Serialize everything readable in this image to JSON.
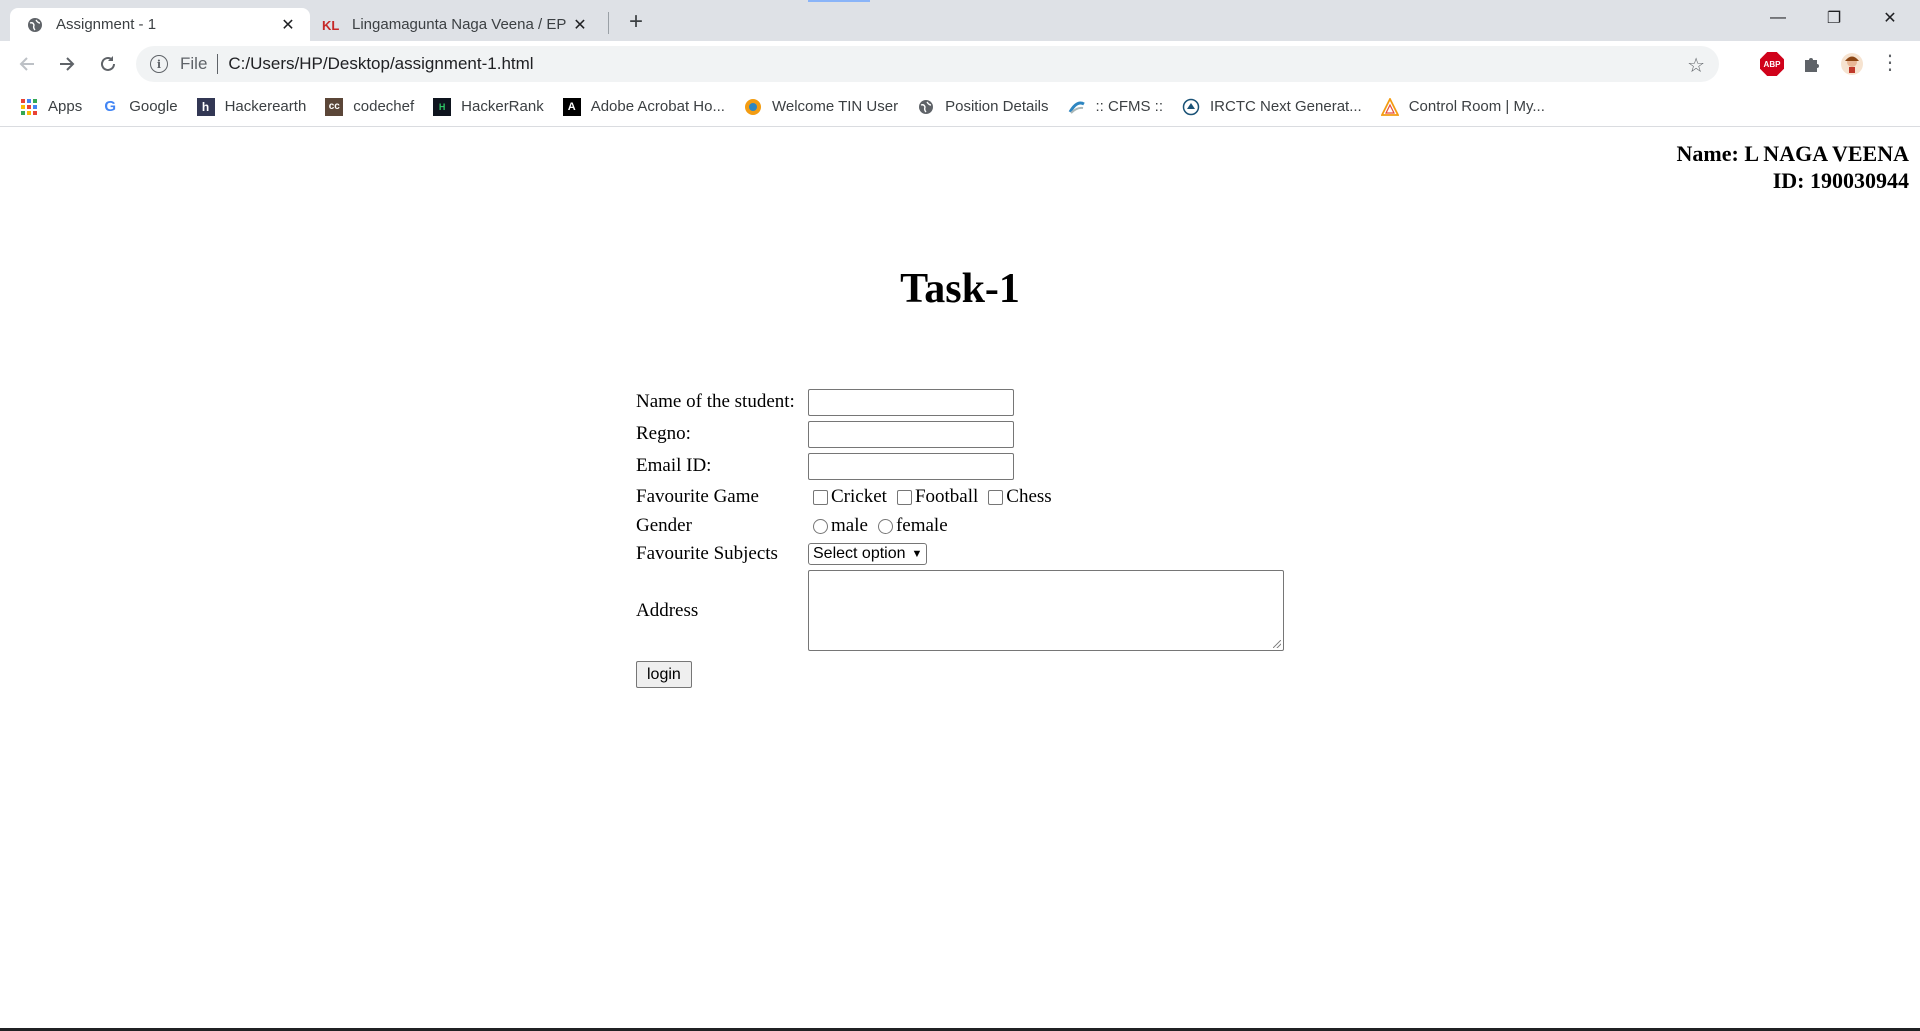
{
  "browser": {
    "tabs": [
      {
        "title": "Assignment - 1",
        "icon": "globe-icon",
        "active": true
      },
      {
        "title": "Lingamagunta Naga Veena / EP S",
        "icon": "kl-icon",
        "active": false
      }
    ],
    "close_glyph": "✕",
    "new_tab_glyph": "+",
    "window_controls": {
      "minimize": "—",
      "restore": "❐",
      "close": "✕"
    },
    "address": {
      "scheme": "File",
      "url": "C:/Users/HP/Desktop/assignment-1.html"
    },
    "extensions": [
      {
        "name": "adblock-plus",
        "text": "ABP"
      },
      {
        "name": "puzzle"
      },
      {
        "name": "profile"
      }
    ]
  },
  "bookmarks": [
    {
      "label": "Apps",
      "icon": "apps-grid-icon"
    },
    {
      "label": "Google",
      "icon": "google-icon"
    },
    {
      "label": "Hackerearth",
      "icon": "hackerearth-icon"
    },
    {
      "label": "codechef",
      "icon": "codechef-icon"
    },
    {
      "label": "HackerRank",
      "icon": "hackerrank-icon"
    },
    {
      "label": "Adobe Acrobat Ho...",
      "icon": "adobe-acrobat-icon"
    },
    {
      "label": "Welcome TIN User",
      "icon": "tin-icon"
    },
    {
      "label": "Position Details",
      "icon": "globe-icon"
    },
    {
      "label": ":: CFMS ::",
      "icon": "cfms-icon"
    },
    {
      "label": "IRCTC Next Generat...",
      "icon": "irctc-icon"
    },
    {
      "label": "Control Room | My...",
      "icon": "control-room-icon"
    }
  ],
  "page": {
    "ident_name": "Name: L NAGA VEENA",
    "ident_id": "ID: 190030944",
    "title": "Task-1",
    "form": {
      "name_label": "Name of the student:",
      "regno_label": "Regno:",
      "email_label": "Email ID:",
      "game_label": "Favourite Game",
      "games": [
        "Cricket",
        "Football",
        "Chess"
      ],
      "gender_label": "Gender",
      "genders": [
        "male",
        "female"
      ],
      "subjects_label": "Favourite Subjects",
      "subjects_selected": "Select option",
      "address_label": "Address",
      "login_label": "login"
    }
  },
  "colors": {
    "tabstrip": "#dee1e6",
    "omnibox": "#f1f3f4",
    "abp": "#d0021b"
  }
}
